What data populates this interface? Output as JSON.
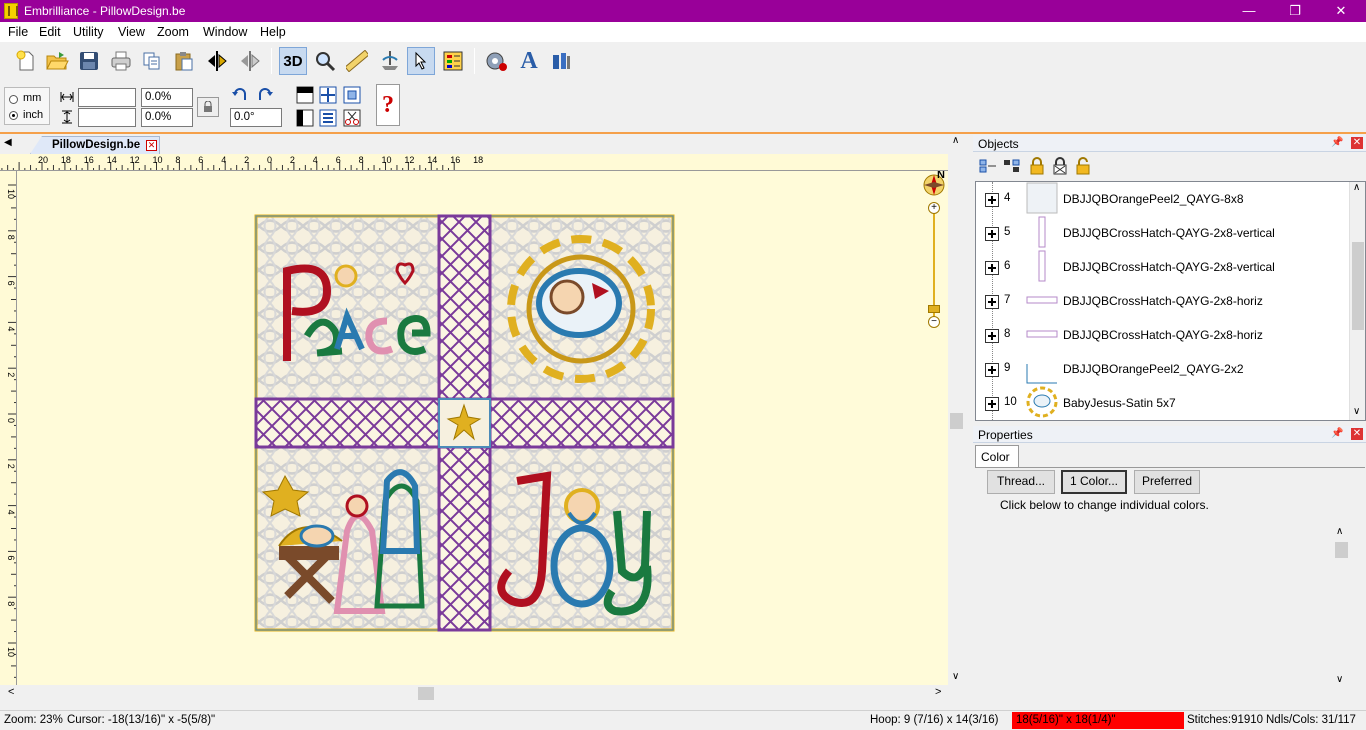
{
  "window": {
    "title": "Embrilliance - PillowDesign.be",
    "minimize": "—",
    "restore": "❐",
    "close": "✕"
  },
  "menu": [
    "File",
    "Edit",
    "Utility",
    "View",
    "Zoom",
    "Window",
    "Help"
  ],
  "toolbar": {
    "view3d_label": "3D"
  },
  "units": {
    "mm_label": "mm",
    "inch_label": "inch",
    "selected": "inch"
  },
  "sizing": {
    "width_value": "",
    "height_value": "",
    "width_pct": "0.0%",
    "height_pct": "0.0%",
    "rotation": "0.0°"
  },
  "document": {
    "tab_label": "PillowDesign.be"
  },
  "rulers": {
    "h_ticks": [
      "20",
      "18",
      "16",
      "14",
      "12",
      "10",
      "8",
      "6",
      "4",
      "2",
      "0",
      "2",
      "4",
      "6",
      "8",
      "10",
      "12",
      "14",
      "16",
      "18"
    ],
    "v_ticks": [
      "10",
      "8",
      "6",
      "4",
      "2",
      "0",
      "2",
      "4",
      "6",
      "8",
      "10",
      "12"
    ]
  },
  "compass": {
    "north_label": "N"
  },
  "design": {
    "peace_text": "Peace",
    "joy_text": "Joy",
    "colors": {
      "canvas": "#fffbd9",
      "block_fill": "#f6f0df",
      "lattice": "#cfcfcf",
      "crosshatch": "#7a3a9a",
      "gold": "#e0b020",
      "red": "#b01020",
      "green": "#1a7a40",
      "teal": "#2a7ab0",
      "brown": "#7a4a2a",
      "pink": "#e090b0"
    }
  },
  "objects_panel": {
    "title": "Objects",
    "items": [
      {
        "num": "4",
        "name": "DBJJQBOrangePeel2_QAYG-8x8",
        "thumb": "block"
      },
      {
        "num": "5",
        "name": "DBJJQBCrossHatch-QAYG-2x8-vertical",
        "thumb": "vertical"
      },
      {
        "num": "6",
        "name": "DBJJQBCrossHatch-QAYG-2x8-vertical",
        "thumb": "vertical"
      },
      {
        "num": "7",
        "name": "DBJJQBCrossHatch-QAYG-2x8-horiz",
        "thumb": "horiz"
      },
      {
        "num": "8",
        "name": "DBJJQBCrossHatch-QAYG-2x8-horiz",
        "thumb": "horiz"
      },
      {
        "num": "9",
        "name": "DBJJQBOrangePeel2_QAYG-2x2",
        "thumb": "corner"
      },
      {
        "num": "10",
        "name": "BabyJesus-Satin 5x7",
        "thumb": "baby"
      }
    ]
  },
  "properties_panel": {
    "title": "Properties",
    "tab": "Color",
    "thread_btn": "Thread...",
    "color_btn": "1 Color...",
    "preferred_btn": "Preferred",
    "hint": "Click below to change individual colors."
  },
  "status": {
    "zoom": "Zoom: 23%",
    "cursor": "Cursor: -18(13/16)\" x -5(5/8)\"",
    "hoop": "Hoop: 9 (7/16) x 14(3/16)",
    "design_size": "18(5/16)\" x 18(1/4)\"",
    "stitches": "Stitches:91910",
    "ndls": "Ndls/Cols: 31/117",
    "size_alert_color": "#ff0000"
  }
}
